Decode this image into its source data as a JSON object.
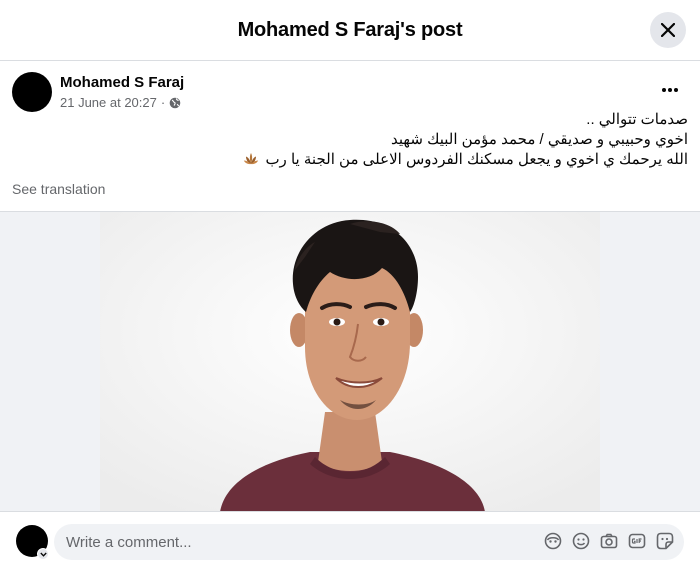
{
  "header": {
    "title": "Mohamed S Faraj's post"
  },
  "post": {
    "author": "Mohamed S Faraj",
    "date": "21 June at 20:27",
    "separator": "·",
    "privacy_icon": "globe-icon",
    "lines": [
      "صدمات تتوالي ..",
      "اخوي وحبيبي و صديقي / محمد مؤمن البيك شهيد",
      "الله يرحمك ي اخوي و يجعل مسكنك الفردوس الاعلى من الجنة يا رب"
    ],
    "emoji_icon": "lotus-icon",
    "see_translation": "See translation"
  },
  "comment": {
    "placeholder": "Write a comment...",
    "icons": [
      "avatar-sticker-icon",
      "emoji-icon",
      "camera-icon",
      "gif-icon",
      "sticker-icon"
    ]
  },
  "colors": {
    "background": "#ffffff",
    "secondary_text": "#65676b",
    "input_bg": "#f0f2f5",
    "shirt": "#6b2f3b"
  }
}
